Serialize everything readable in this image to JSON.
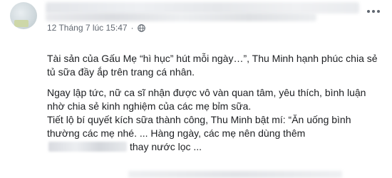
{
  "post": {
    "timestamp": "12 Tháng 7 lúc 15:47",
    "separator": "·",
    "privacy_icon": "globe-icon",
    "more_icon": "more-options-icon",
    "paragraphs": {
      "p1": "Tài sản của Gấu Mẹ “hì hục” hút mỗi ngày…”, Thu Minh hạnh phúc chia sẻ tủ sữa đầy ắp trên trang cá nhân.",
      "p2": "Ngay lập tức, nữ ca sĩ nhận được vô vàn quan tâm, yêu thích, bình luận nhờ chia sẻ kinh nghiệm của các mẹ bỉm sữa.",
      "p3_before": "Tiết lộ bí quyết kích sữa thành công, Thu Minh bật mí: “Ăn uống bình thường các mẹ nhé. ... Hàng ngày, các mẹ nên dùng thêm",
      "p3_after": "thay nước lọc ..."
    }
  },
  "colors": {
    "text_primary": "#1c1e21",
    "text_secondary": "#606770",
    "background": "#ffffff"
  }
}
